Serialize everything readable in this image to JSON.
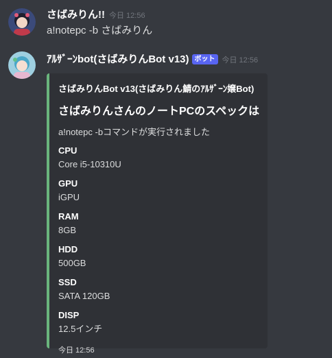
{
  "messages": [
    {
      "username": "さばみりん!!",
      "timestamp": "今日 12:56",
      "text": "a!notepc -b さばみりん"
    },
    {
      "username": "ｱﾙｻﾞｰﾝbot(さばみりんBot v13)",
      "bot_tag": "ボット",
      "timestamp": "今日 12:56",
      "embed": {
        "author": "さばみりんBot v13(さばみりん鯖のｱﾙｻﾞｰﾝ嬢Bot)",
        "title": "さばみりんさんのノートPCのスペックは",
        "description": "a!notepc -bコマンドが実行されました",
        "fields": [
          {
            "name": "CPU",
            "value": "Core i5-10310U"
          },
          {
            "name": "GPU",
            "value": "iGPU"
          },
          {
            "name": "RAM",
            "value": "8GB"
          },
          {
            "name": "HDD",
            "value": "500GB"
          },
          {
            "name": "SSD",
            "value": "SATA 120GB"
          },
          {
            "name": "DISP",
            "value": "12.5インチ"
          }
        ],
        "footer": "今日 12:56",
        "accent_color": "#6ab57d"
      }
    }
  ]
}
